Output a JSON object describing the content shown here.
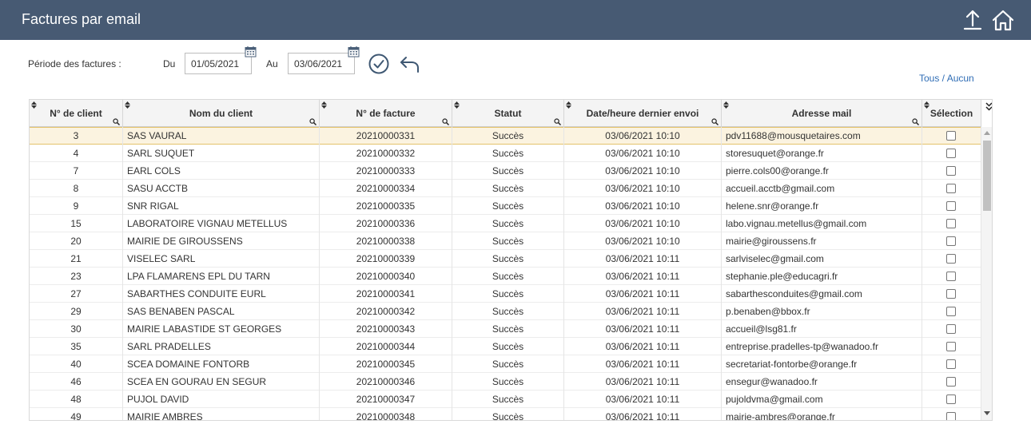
{
  "header": {
    "title": "Factures par email",
    "upload_icon": "upload-icon",
    "home_icon": "home-icon"
  },
  "filters": {
    "period_label": "Période des factures :",
    "from_label": "Du",
    "from_value": "01/05/2021",
    "to_label": "Au",
    "to_value": "03/06/2021",
    "calendar_icon": "calendar-icon",
    "validate_icon": "check-circle-icon",
    "back_icon": "undo-arrow-icon"
  },
  "select_all_none": "Tous / Aucun",
  "table": {
    "columns": [
      {
        "label": "N° de client"
      },
      {
        "label": "Nom du client"
      },
      {
        "label": "N° de facture"
      },
      {
        "label": "Statut"
      },
      {
        "label": "Date/heure dernier envoi"
      },
      {
        "label": "Adresse mail"
      },
      {
        "label": "Sélection"
      }
    ],
    "rows": [
      {
        "client": "3",
        "name": "SAS VAURAL",
        "invoice": "20210000331",
        "status": "Succès",
        "date": "03/06/2021 10:10",
        "email": "pdv11688@mousquetaires.com",
        "selected": false
      },
      {
        "client": "4",
        "name": "SARL SUQUET",
        "invoice": "20210000332",
        "status": "Succès",
        "date": "03/06/2021 10:10",
        "email": "storesuquet@orange.fr",
        "selected": false
      },
      {
        "client": "7",
        "name": "EARL COLS",
        "invoice": "20210000333",
        "status": "Succès",
        "date": "03/06/2021 10:10",
        "email": "pierre.cols00@orange.fr",
        "selected": false
      },
      {
        "client": "8",
        "name": "SASU ACCTB",
        "invoice": "20210000334",
        "status": "Succès",
        "date": "03/06/2021 10:10",
        "email": "accueil.acctb@gmail.com",
        "selected": false
      },
      {
        "client": "9",
        "name": "SNR RIGAL",
        "invoice": "20210000335",
        "status": "Succès",
        "date": "03/06/2021 10:10",
        "email": "helene.snr@orange.fr",
        "selected": false
      },
      {
        "client": "15",
        "name": "LABORATOIRE VIGNAU METELLUS",
        "invoice": "20210000336",
        "status": "Succès",
        "date": "03/06/2021 10:10",
        "email": "labo.vignau.metellus@gmail.com",
        "selected": false
      },
      {
        "client": "20",
        "name": "MAIRIE DE GIROUSSENS",
        "invoice": "20210000338",
        "status": "Succès",
        "date": "03/06/2021 10:10",
        "email": "mairie@giroussens.fr",
        "selected": false
      },
      {
        "client": "21",
        "name": "VISELEC SARL",
        "invoice": "20210000339",
        "status": "Succès",
        "date": "03/06/2021 10:11",
        "email": "sarlviselec@gmail.com",
        "selected": false
      },
      {
        "client": "23",
        "name": "LPA FLAMARENS EPL DU TARN",
        "invoice": "20210000340",
        "status": "Succès",
        "date": "03/06/2021 10:11",
        "email": "stephanie.ple@educagri.fr",
        "selected": false
      },
      {
        "client": "27",
        "name": "SABARTHES CONDUITE EURL",
        "invoice": "20210000341",
        "status": "Succès",
        "date": "03/06/2021 10:11",
        "email": "sabarthesconduites@gmail.com",
        "selected": false
      },
      {
        "client": "29",
        "name": "SAS BENABEN PASCAL",
        "invoice": "20210000342",
        "status": "Succès",
        "date": "03/06/2021 10:11",
        "email": "p.benaben@bbox.fr",
        "selected": false
      },
      {
        "client": "30",
        "name": "MAIRIE LABASTIDE ST GEORGES",
        "invoice": "20210000343",
        "status": "Succès",
        "date": "03/06/2021 10:11",
        "email": "accueil@lsg81.fr",
        "selected": false
      },
      {
        "client": "35",
        "name": "SARL PRADELLES",
        "invoice": "20210000344",
        "status": "Succès",
        "date": "03/06/2021 10:11",
        "email": "entreprise.pradelles-tp@wanadoo.fr",
        "selected": false
      },
      {
        "client": "40",
        "name": "SCEA DOMAINE FONTORB",
        "invoice": "20210000345",
        "status": "Succès",
        "date": "03/06/2021 10:11",
        "email": "secretariat-fontorbe@orange.fr",
        "selected": false
      },
      {
        "client": "46",
        "name": "SCEA EN GOURAU EN SEGUR",
        "invoice": "20210000346",
        "status": "Succès",
        "date": "03/06/2021 10:11",
        "email": "ensegur@wanadoo.fr",
        "selected": false
      },
      {
        "client": "48",
        "name": "PUJOL DAVID",
        "invoice": "20210000347",
        "status": "Succès",
        "date": "03/06/2021 10:11",
        "email": "pujoldvma@gmail.com",
        "selected": false
      },
      {
        "client": "49",
        "name": "MAIRIE AMBRES",
        "invoice": "20210000348",
        "status": "Succès",
        "date": "03/06/2021 10:11",
        "email": "mairie-ambres@orange.fr",
        "selected": false
      }
    ]
  },
  "colors": {
    "header_bg": "#475a73",
    "link": "#2f6db5",
    "selected_row_bg": "#fbf3e0",
    "selected_row_border": "#e4c36b",
    "action_icon": "#3f5873"
  }
}
